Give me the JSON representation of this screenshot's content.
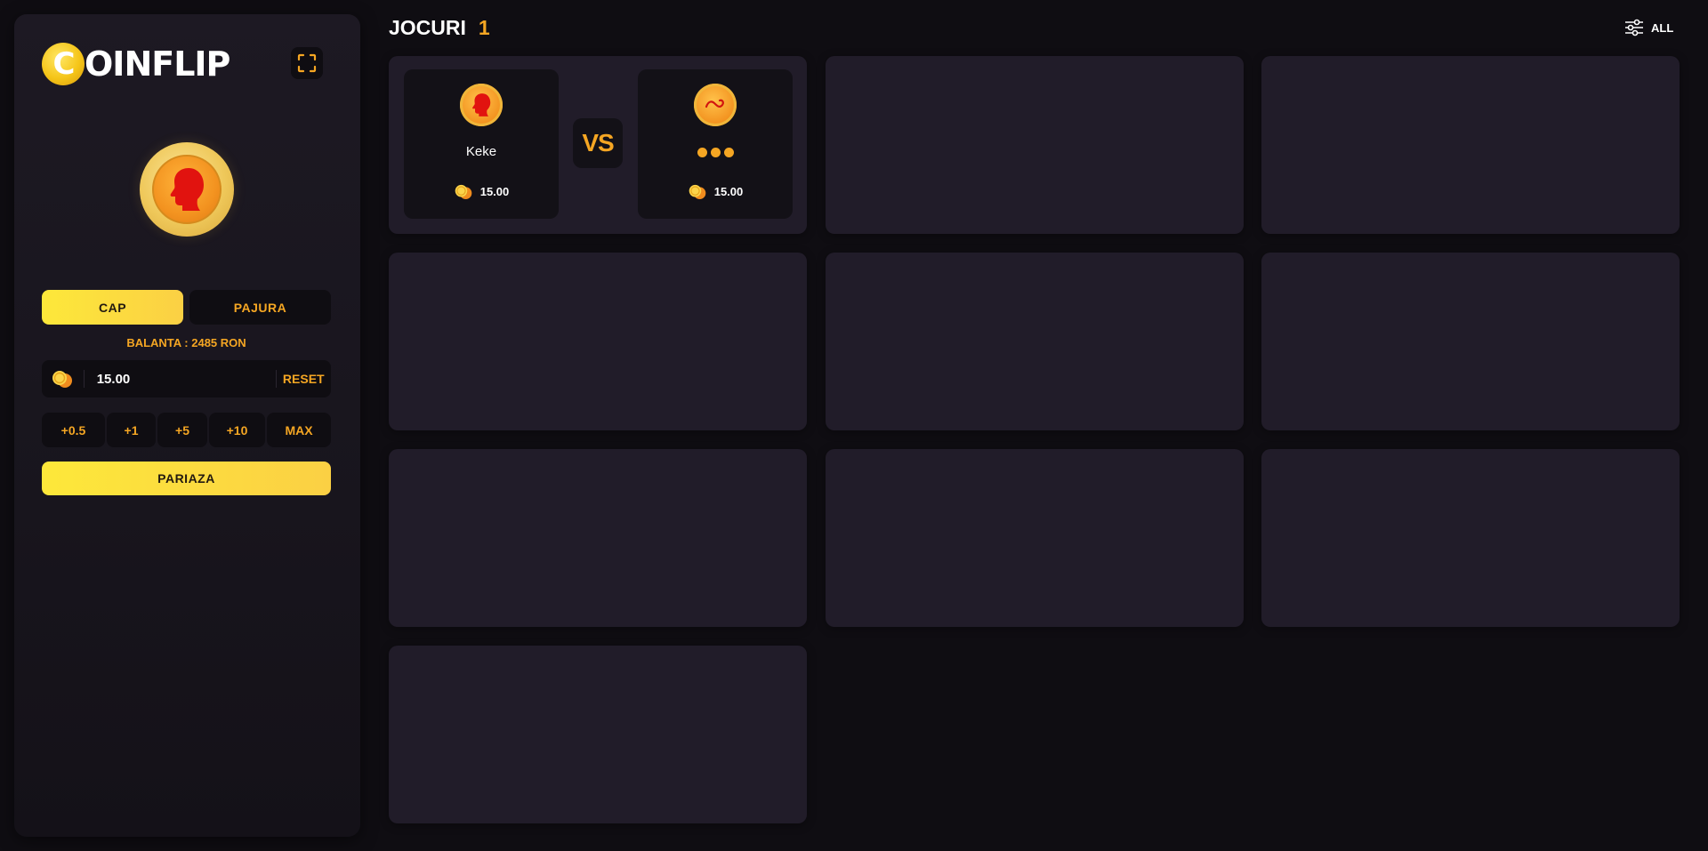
{
  "app": {
    "logo_letter": "C",
    "logo_text": "OINFLIP"
  },
  "sidebar": {
    "side_options": [
      {
        "label": "CAP",
        "selected": true
      },
      {
        "label": "PAJURA",
        "selected": false
      }
    ],
    "balance_text": "BALANTA : 2485 RON",
    "bet_value": "15.00",
    "reset_label": "RESET",
    "quick_buttons": [
      "+0.5",
      "+1",
      "+5",
      "+10",
      "MAX"
    ],
    "place_bet_label": "PARIAZA"
  },
  "header": {
    "title": "JOCURI",
    "count": "1",
    "filter_label": "ALL"
  },
  "games": [
    {
      "player1": {
        "name": "Keke",
        "amount": "15.00",
        "side": "cap"
      },
      "player2": {
        "name": "",
        "amount": "15.00",
        "side": "pajura",
        "waiting": true
      },
      "vs_label": "VS"
    }
  ],
  "colors": {
    "accent": "#f5a623",
    "accent_yellow": "#fde83a",
    "background": "#0f0d12",
    "card": "#211c29",
    "panel": "#1b1720"
  }
}
